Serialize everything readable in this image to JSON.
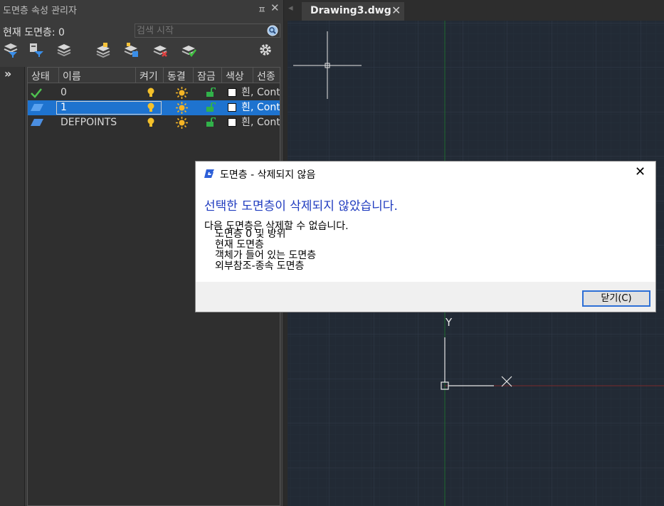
{
  "palette": {
    "title": "도면층 속성 관리자",
    "current_layer": "현재 도면층: 0",
    "search_placeholder": "검색 시작",
    "columns": [
      "상태",
      "이름",
      "켜기",
      "동결",
      "잠금",
      "색상",
      "선종"
    ],
    "rows": [
      {
        "status": "current",
        "name": "0",
        "color_label": "흰",
        "linetype": "Cont",
        "selected": false
      },
      {
        "status": "normal",
        "name": "1",
        "color_label": "흰",
        "linetype": "Cont",
        "selected": true
      },
      {
        "status": "normal",
        "name": "DEFPOINTS",
        "color_label": "흰",
        "linetype": "Cont",
        "selected": false
      }
    ]
  },
  "tab": {
    "name": "Drawing3.dwg"
  },
  "canvas": {
    "ucs_y_label": "Y",
    "ucs_x_label": "X"
  },
  "dialog": {
    "title": "도면층 - 삭제되지 않음",
    "main_instruction": "선택한 도면층이 삭제되지 않았습니다.",
    "intro": "다음 도면층은 삭제할 수 없습니다.",
    "items": [
      "도면층 0 및 방위",
      "현재 도면층",
      "객체가 들어 있는 도면층",
      "외부참조-종속 도면층"
    ],
    "close_button": "닫기(C)"
  },
  "colors": {
    "accent": "#1e73cf",
    "canvas_bg": "#222a35",
    "dialog_main_text": "#1f3bbf"
  }
}
